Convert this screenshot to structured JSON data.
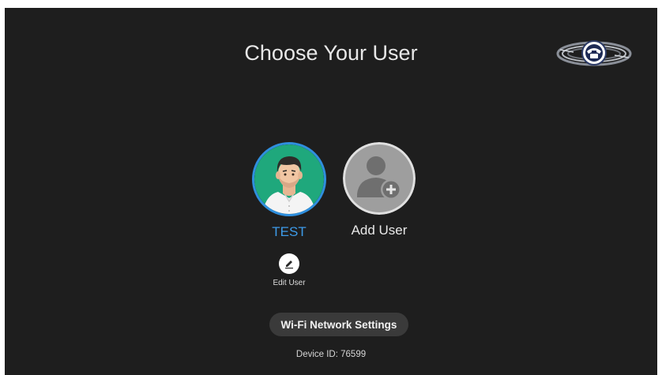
{
  "header": {
    "title": "Choose Your User",
    "logo_icon": "telephone-globe-logo"
  },
  "users": [
    {
      "label": "TEST",
      "icon": "male-avatar-icon",
      "selected": true
    },
    {
      "label": "Add User",
      "icon": "add-user-icon",
      "selected": false
    }
  ],
  "edit": {
    "label": "Edit User",
    "icon": "pencil-icon"
  },
  "wifi": {
    "label": "Wi-Fi Network Settings"
  },
  "device": {
    "id_text": "Device ID: 76599"
  },
  "colors": {
    "background": "#1e1e1e",
    "accent": "#3d9be9",
    "avatar_green": "#1fa87c",
    "add_user_gray": "#9e9e9e"
  }
}
